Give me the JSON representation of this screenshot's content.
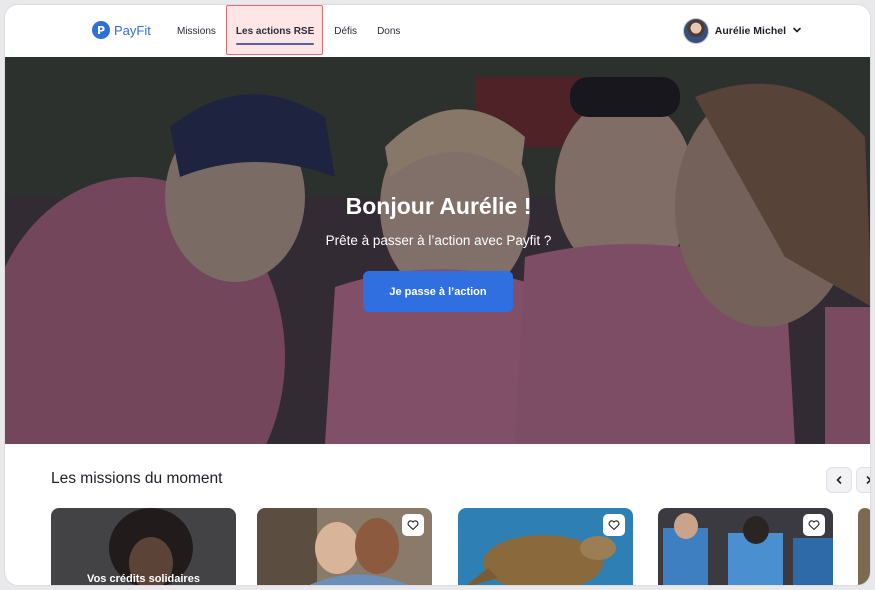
{
  "brand": {
    "name": "PayFit",
    "logo_mark": "P",
    "accent": "#2f6fd9"
  },
  "nav": {
    "items": [
      {
        "label": "Missions",
        "active": false
      },
      {
        "label": "Les actions RSE",
        "active": true
      },
      {
        "label": "Défis",
        "active": false
      },
      {
        "label": "Dons",
        "active": false
      }
    ]
  },
  "user": {
    "name": "Aurélie Michel",
    "chevron_icon": "chevron-down-icon",
    "avatar_icon": "user-avatar"
  },
  "hero": {
    "title": "Bonjour Aurélie !",
    "subtitle": "Prête à passer à l’action avec Payfit ?",
    "cta_label": "Je passe à l’action",
    "cta_color": "#2f6fe0"
  },
  "missions": {
    "title": "Les missions du moment",
    "prev_icon": "chevron-left-icon",
    "next_icon": "chevron-right-icon",
    "cards": [
      {
        "label": "Vos crédits solidaires",
        "has_heart": false
      },
      {
        "label": "",
        "has_heart": true,
        "heart_icon": "heart-icon"
      },
      {
        "label": "",
        "has_heart": true,
        "heart_icon": "heart-icon"
      },
      {
        "label": "",
        "has_heart": true,
        "heart_icon": "heart-icon"
      }
    ]
  }
}
